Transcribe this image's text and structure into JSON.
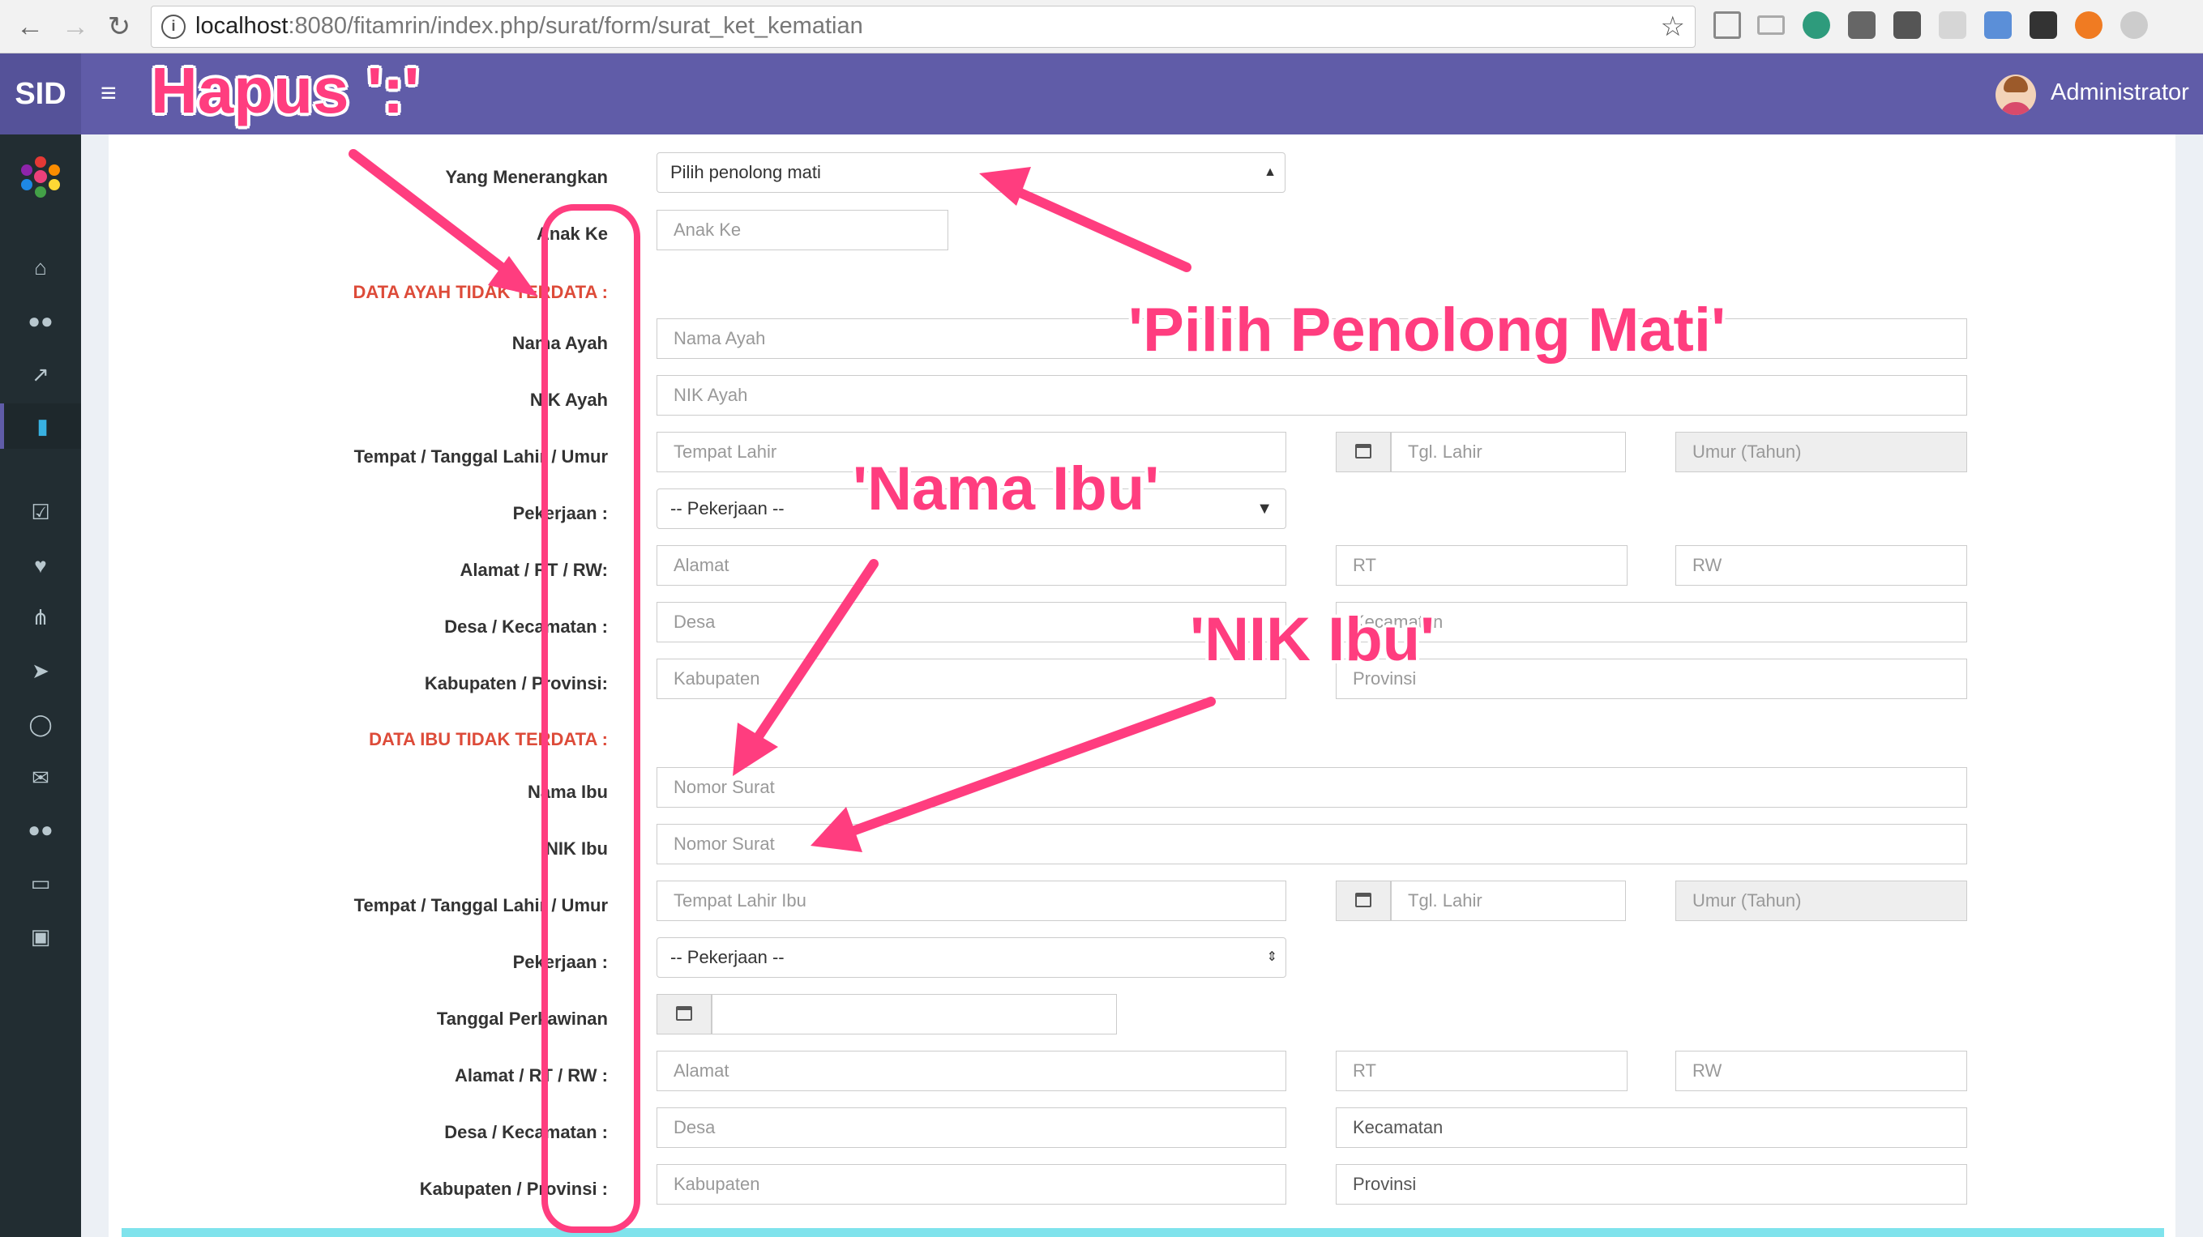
{
  "browser": {
    "url_host": "localhost",
    "url_path": ":8080/fitamrin/index.php/surat/form/surat_ket_kematian"
  },
  "header": {
    "logo": "SID",
    "user_name": "Administrator"
  },
  "form": {
    "yang_menerangkan_label": "Yang Menerangkan",
    "yang_menerangkan_select": "Pilih penolong mati",
    "anak_ke_label": "Anak Ke",
    "anak_ke_placeholder": "Anak Ke",
    "ayah_section": "DATA AYAH TIDAK TERDATA :",
    "nama_ayah_label": "Nama Ayah",
    "nama_ayah_placeholder": "Nama Ayah",
    "nik_ayah_label": "NIK Ayah",
    "nik_ayah_placeholder": "NIK Ayah",
    "ttl_label": "Tempat / Tanggal Lahir / Umur",
    "tempat_lahir_placeholder": "Tempat Lahir",
    "tgl_lahir_placeholder": "Tgl. Lahir",
    "umur_placeholder": "Umur (Tahun)",
    "pekerjaan_label": "Pekerjaan :",
    "pekerjaan_select": "-- Pekerjaan --",
    "alamat_label_ayah": "Alamat / RT / RW:",
    "alamat_placeholder": "Alamat",
    "rt_placeholder": "RT",
    "rw_placeholder": "RW",
    "desa_label": "Desa / Kecamatan :",
    "desa_placeholder": "Desa",
    "kecamatan_placeholder": "Kecamatan",
    "kabupaten_label_ayah": "Kabupaten / Provinsi:",
    "kabupaten_placeholder": "Kabupaten",
    "provinsi_placeholder": "Provinsi",
    "ibu_section": "DATA IBU TIDAK TERDATA :",
    "nama_ibu_label": "Nama Ibu",
    "nama_ibu_placeholder": "Nomor Surat",
    "nik_ibu_label": "NIK Ibu",
    "nik_ibu_placeholder": "Nomor Surat",
    "tempat_lahir_ibu_placeholder": "Tempat Lahir Ibu",
    "tanggal_perkawinan_label": "Tanggal Perkawinan",
    "alamat_label_ibu": "Alamat / RT / RW :",
    "kabupaten_label_ibu": "Kabupaten / Provinsi :"
  },
  "annotations": {
    "hapus": "Hapus ':'",
    "pilih_penolong": "'Pilih Penolong Mati'",
    "nama_ibu": "'Nama Ibu'",
    "nik_ibu": "'NIK Ibu'"
  },
  "colors": {
    "header": "#605ca8",
    "sidebar": "#222d32",
    "annotation": "#ff3d7f",
    "section_label": "#dd4b39"
  },
  "sidebar_icons": [
    "home-icon",
    "users-icon",
    "chart-icon",
    "book-icon",
    "check-square-icon",
    "heart-icon",
    "signs-icon",
    "location-arrow-icon",
    "globe-icon",
    "envelope-icon",
    "users-icon",
    "desktop-icon",
    "inbox-icon"
  ]
}
